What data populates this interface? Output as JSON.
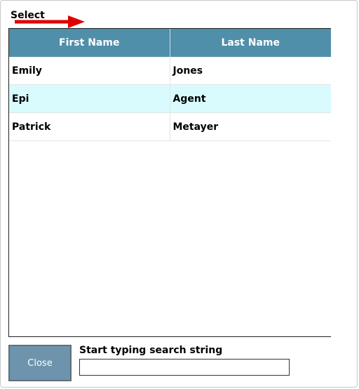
{
  "dialog": {
    "title": "Select"
  },
  "grid": {
    "columns": [
      "First Name",
      "Last Name"
    ],
    "rows": [
      [
        "Emily",
        "Jones"
      ],
      [
        "Epi",
        "Agent"
      ],
      [
        "Patrick",
        "Metayer"
      ]
    ]
  },
  "footer": {
    "close_label": "Close",
    "search_label": "Start typing search string",
    "search_value": ""
  },
  "colors": {
    "header_bg": "#4f8fa9",
    "alt_row_bg": "#d9fbfd",
    "close_button_bg": "#6d94ac",
    "arrow": "#e00000"
  },
  "icons": {
    "annotation": "red-arrow-icon"
  }
}
